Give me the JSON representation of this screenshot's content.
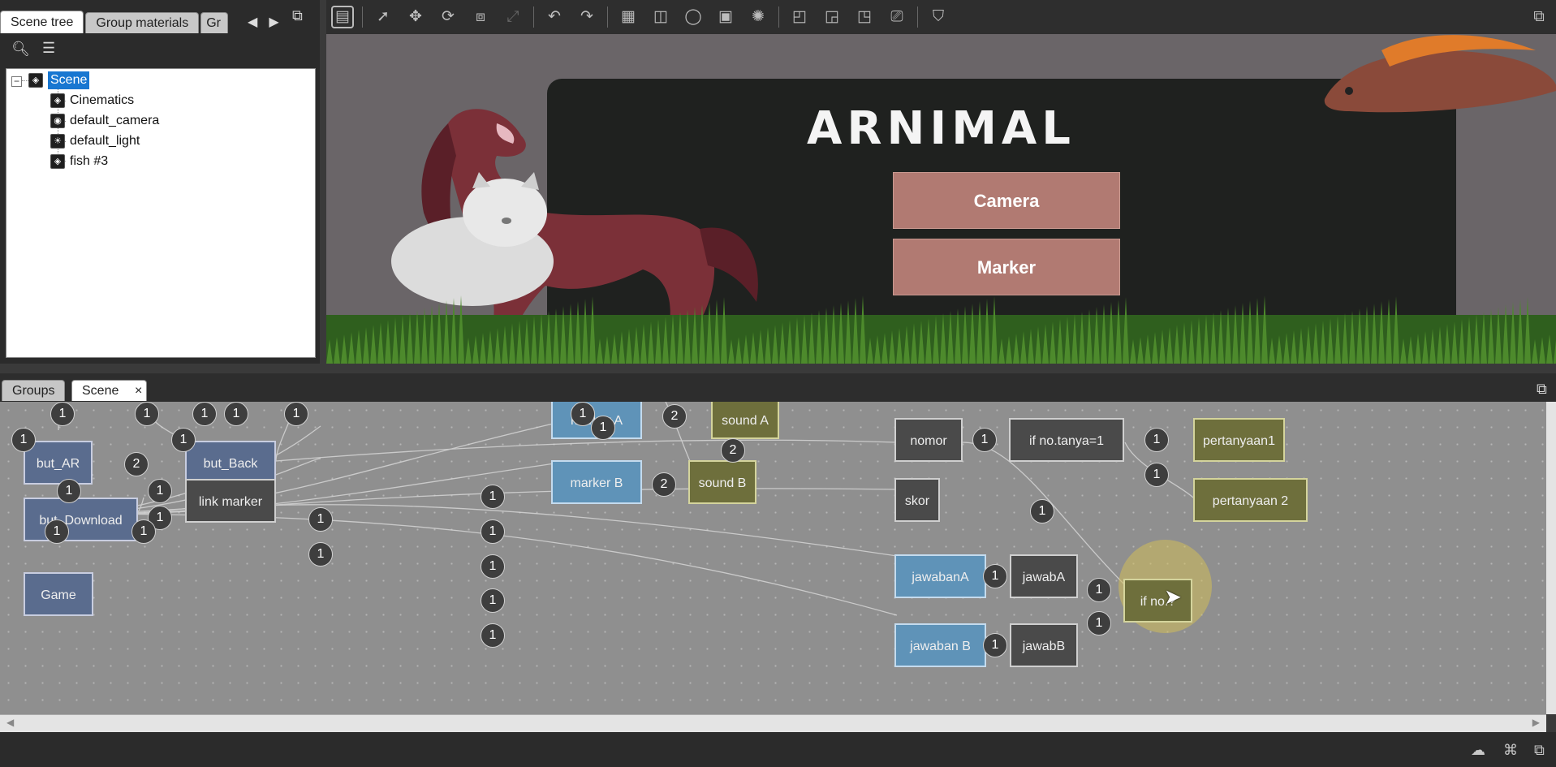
{
  "left_panel": {
    "tabs": [
      "Scene tree",
      "Group materials",
      "Gr"
    ],
    "tree": {
      "root": "Scene",
      "children": [
        "Cinematics",
        "default_camera",
        "default_light",
        "fish #3"
      ]
    }
  },
  "viewport": {
    "title": "ARNIMAL",
    "buttons": [
      "Camera",
      "Marker"
    ]
  },
  "bottom": {
    "tabs": [
      "Groups",
      "Scene"
    ],
    "close": "×"
  },
  "graph": {
    "nodes": {
      "but_ar": "but_AR",
      "but_back": "but_Back",
      "but_download": "but_Download",
      "link_marker": "link marker",
      "game": "Game",
      "marker_a": "marker A",
      "sound_a": "sound A",
      "marker_b": "marker B",
      "sound_b": "sound B",
      "nomor": "nomor",
      "if_no_tanya": "if no.tanya=1",
      "pertanyaan1": "pertanyaan1",
      "pertanyaan2": "pertanyaan 2",
      "skor": "skor",
      "jawabanA": "jawabanA",
      "jawabA": "jawabA",
      "jawabanB": "jawaban B",
      "jawabB": "jawabB",
      "if_no": "if no.?"
    },
    "badge_values": [
      "1",
      "2"
    ]
  },
  "colors": {
    "selection": "#1877d1",
    "menu_button": "#b17a72",
    "graph_bg": "#8f8f8f",
    "node_blue": "#5a6c8e",
    "node_light_blue": "#5f93b8",
    "node_olive": "#6e6f3c"
  }
}
